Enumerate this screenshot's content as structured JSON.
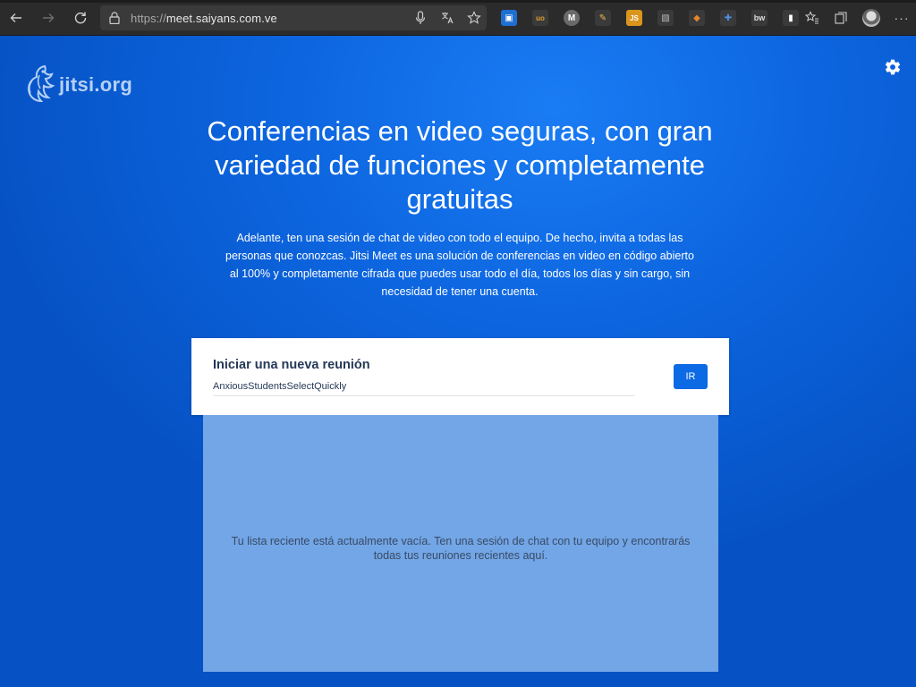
{
  "browser": {
    "url_scheme": "https://",
    "url_host": "meet.saiyans.com.ve",
    "back_icon": "arrow-left-icon",
    "forward_icon": "arrow-right-icon",
    "refresh_icon": "refresh-icon",
    "extensions": [
      {
        "name": "ext-blue-square",
        "color": "#1f6fd1",
        "glyph": "▣"
      },
      {
        "name": "ext-ublock",
        "color": "#3a3a3a",
        "glyph": "uo"
      },
      {
        "name": "ext-m-circle",
        "color": "#5a5a5a",
        "glyph": "M"
      },
      {
        "name": "ext-pen",
        "color": "#3a3a3a",
        "glyph": "✎"
      },
      {
        "name": "ext-js",
        "color": "#d9951c",
        "glyph": "JS"
      },
      {
        "name": "ext-image",
        "color": "#3a3a3a",
        "glyph": "▧"
      },
      {
        "name": "ext-metamask",
        "color": "#c9771f",
        "glyph": "◆"
      },
      {
        "name": "ext-plus",
        "color": "#3a3a3a",
        "glyph": "✚"
      },
      {
        "name": "ext-bw",
        "color": "#3a3a3a",
        "glyph": "bw"
      },
      {
        "name": "ext-bookmark",
        "color": "#3a3a3a",
        "glyph": "▮"
      }
    ]
  },
  "brand": {
    "logo_text": "jitsi.org"
  },
  "hero": {
    "headline": "Conferencias en video seguras, con gran variedad de funciones y completamente gratuitas",
    "description": "Adelante, ten una sesión de chat de video con todo el equipo. De hecho, invita a todas las personas que conozcas. Jitsi Meet es una solución de conferencias en video en código abierto al 100% y completamente cifrada que puedes usar todo el día, todos los días y sin cargo, sin necesidad de tener una cuenta."
  },
  "meeting": {
    "title": "Iniciar una nueva reunión",
    "room_value": "AnxiousStudentsSelectQuickly",
    "go_label": "IR"
  },
  "recent": {
    "empty_message": "Tu lista reciente está actualmente vacía. Ten una sesión de chat con tu equipo y encontrarás todas tus reuniones recientes aquí."
  },
  "colors": {
    "page_background": "#0d66e0",
    "button": "#0c6ae4",
    "recent_panel": "#72a6e6"
  }
}
